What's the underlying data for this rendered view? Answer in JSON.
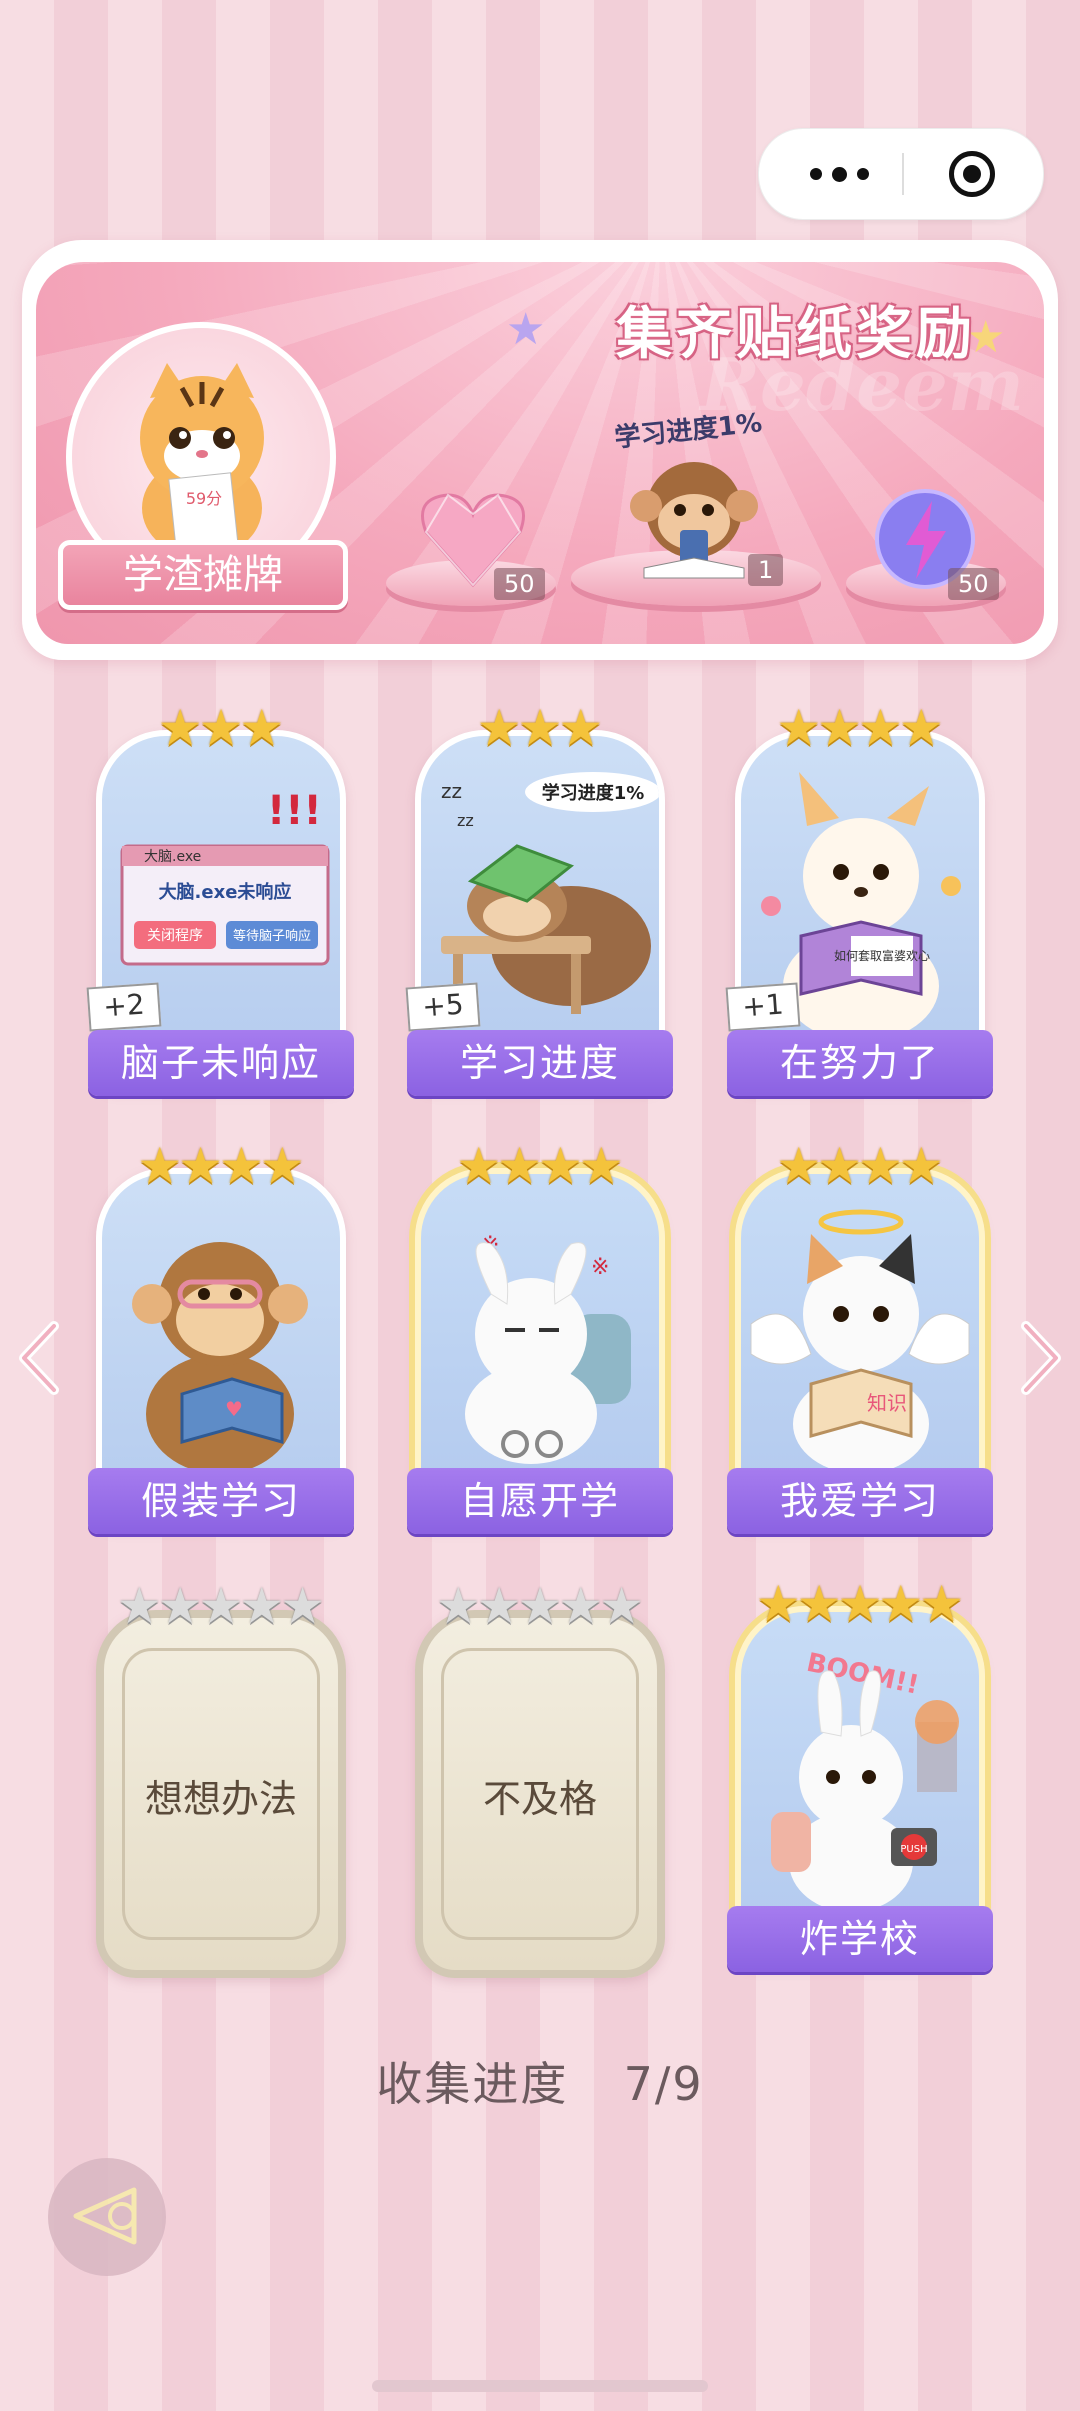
{
  "banner": {
    "title": "集齐贴纸奖励",
    "watermark": "Redeem",
    "avatar_score": "59分",
    "avatar_label": "学渣摊牌",
    "monkey_caption": "学习进度1%",
    "rewards": [
      {
        "name": "heart-gem",
        "count": "50"
      },
      {
        "name": "monkey-sticker",
        "count": "1"
      },
      {
        "name": "lightning-orb",
        "count": "50"
      }
    ]
  },
  "cards": [
    {
      "label": "脑子未响应",
      "stars": 3,
      "bonus": "+2",
      "art_text": "大脑.exe未响应",
      "btn1": "关闭程序",
      "btn2": "等待脑子响应",
      "window_title": "大脑.exe"
    },
    {
      "label": "学习进度",
      "stars": 3,
      "bonus": "+5",
      "art_text": "学习进度1%"
    },
    {
      "label": "在努力了",
      "stars": 4,
      "bonus": "+1",
      "art_text": "如何套取富婆欢心"
    },
    {
      "label": "假装学习",
      "stars": 4
    },
    {
      "label": "自愿开学",
      "stars": 4
    },
    {
      "label": "我爱学习",
      "stars": 4,
      "art_text": "知识"
    },
    {
      "label": "想想办法",
      "stars": 5,
      "locked": true
    },
    {
      "label": "不及格",
      "stars": 5,
      "locked": true
    },
    {
      "label": "炸学校",
      "stars": 5,
      "art_text": "BOOM!!",
      "push": "PUSH"
    }
  ],
  "progress": {
    "label": "收集进度",
    "value": "7/9"
  }
}
